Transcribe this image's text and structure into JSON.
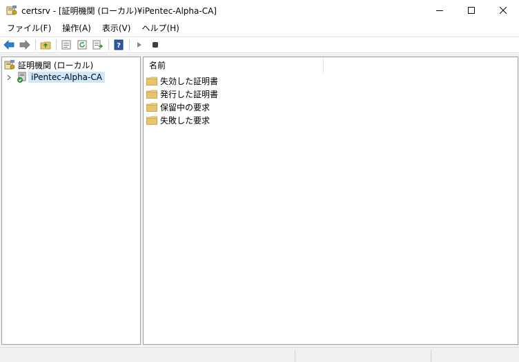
{
  "window": {
    "title": "certsrv - [証明機関 (ローカル)¥iPentec-Alpha-CA]",
    "controls": {
      "minimize": "minimize",
      "maximize": "maximize",
      "close": "close"
    }
  },
  "menu": {
    "items": [
      {
        "label": "ファイル(F)"
      },
      {
        "label": "操作(A)"
      },
      {
        "label": "表示(V)"
      },
      {
        "label": "ヘルプ(H)"
      }
    ]
  },
  "toolbar": {
    "icons": [
      "back-arrow-icon",
      "forward-arrow-icon",
      "up-folder-icon",
      "properties-icon",
      "refresh-icon",
      "export-list-icon",
      "help-icon",
      "start-service-icon",
      "stop-service-icon"
    ]
  },
  "tree": {
    "root_label": "証明機関 (ローカル)",
    "child_label": "iPentec-Alpha-CA"
  },
  "list": {
    "columns": [
      {
        "label": "名前"
      }
    ],
    "items": [
      {
        "label": "失効した証明書"
      },
      {
        "label": "発行した証明書"
      },
      {
        "label": "保留中の要求"
      },
      {
        "label": "失敗した要求"
      }
    ]
  },
  "colors": {
    "selection": "#cce8ff",
    "folder": "#e8c56a",
    "nav_arrow_back": "#2d7dd2",
    "nav_arrow_forward": "#7a7a7a"
  }
}
